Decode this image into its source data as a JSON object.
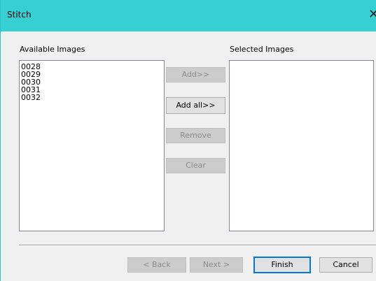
{
  "window": {
    "title": "Stitch",
    "close_glyph": "✕"
  },
  "available": {
    "label": "Available Images",
    "items": [
      "0028",
      "0029",
      "0030",
      "0031",
      "0032"
    ]
  },
  "selected": {
    "label": "Selected Images",
    "items": []
  },
  "actions": {
    "add": "Add>>",
    "add_all": "Add all>>",
    "remove": "Remove",
    "clear": "Clear"
  },
  "footer": {
    "back": "< Back",
    "next": "Next >",
    "finish": "Finish",
    "cancel": "Cancel"
  },
  "colors": {
    "titlebar": "#37d0d2",
    "default_button_border": "#0078d7"
  }
}
